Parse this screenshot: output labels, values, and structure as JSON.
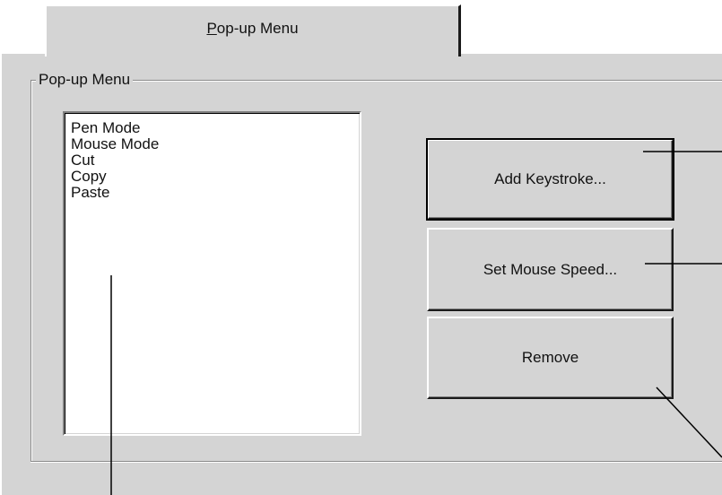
{
  "tab": {
    "label_mnemonic": "P",
    "label_rest": "op-up Menu"
  },
  "groupbox": {
    "legend": "Pop-up Menu"
  },
  "menu_list": {
    "items": [
      "Pen Mode",
      "Mouse Mode",
      "Cut",
      "Copy",
      "Paste"
    ]
  },
  "buttons": {
    "add_keystroke": "Add Keystroke...",
    "set_mouse_speed": "Set Mouse Speed...",
    "remove": "Remove"
  },
  "colors": {
    "face": "#d4d4d4",
    "highlight": "#ffffff",
    "shadow": "#808080",
    "dark_shadow": "#1a1a1a",
    "list_background": "#ffffff"
  }
}
